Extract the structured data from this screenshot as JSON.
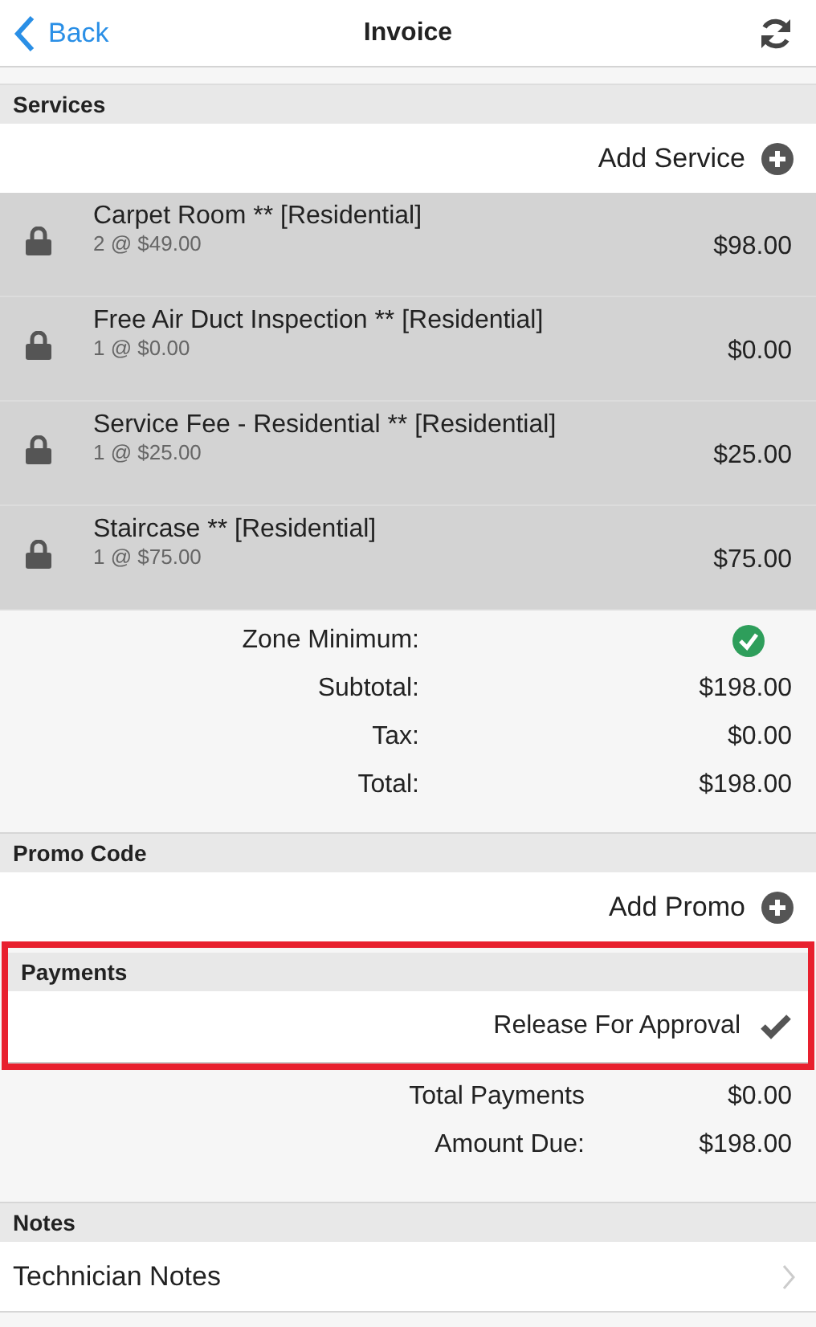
{
  "nav": {
    "back": "Back",
    "title": "Invoice"
  },
  "services": {
    "header": "Services",
    "add": "Add Service",
    "items": [
      {
        "name": "Carpet Room ** [Residential]",
        "detail": "2 @ $49.00",
        "amount": "$98.00",
        "locked": true
      },
      {
        "name": "Free Air Duct Inspection ** [Residential]",
        "detail": "1 @ $0.00",
        "amount": "$0.00",
        "locked": true
      },
      {
        "name": "Service Fee - Residential ** [Residential]",
        "detail": "1 @ $25.00",
        "amount": "$25.00",
        "locked": true
      },
      {
        "name": "Staircase ** [Residential]",
        "detail": "1 @ $75.00",
        "amount": "$75.00",
        "locked": true
      }
    ]
  },
  "totals": [
    {
      "kind": "check",
      "label": "Zone Minimum:",
      "met": true
    },
    {
      "kind": "amount",
      "label": "Subtotal:",
      "value": "$198.00"
    },
    {
      "kind": "amount",
      "label": "Tax:",
      "value": "$0.00"
    },
    {
      "kind": "amount",
      "label": "Total:",
      "value": "$198.00"
    }
  ],
  "promo": {
    "header": "Promo Code",
    "add": "Add Promo"
  },
  "payments": {
    "header": "Payments",
    "highlighted": true,
    "release": "Release For Approval",
    "checked": true
  },
  "payment_totals": [
    {
      "label": "Total Payments",
      "value": "$0.00"
    },
    {
      "label": "Amount Due:",
      "value": "$198.00"
    }
  ],
  "notes": {
    "header": "Notes",
    "item": "Technician Notes"
  }
}
